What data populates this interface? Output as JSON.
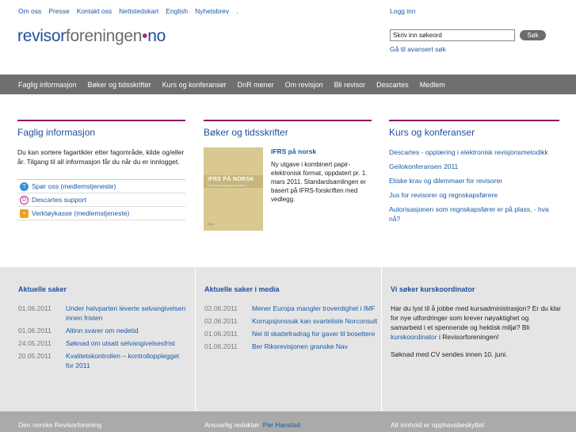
{
  "header": {
    "top_links": [
      "Om oss",
      "Presse",
      "Kontakt oss",
      "Nettstedskart",
      "English",
      "Nyhetsbrev",
      "."
    ],
    "login": "Logg inn",
    "logo": {
      "part1": "revisor",
      "part2": "foreningen",
      "dot": "•",
      "part3": "no"
    },
    "search_value": "Skriv inn søkeord",
    "search_button": "Søk",
    "advanced_search": "Gå til avansert søk"
  },
  "nav": [
    "Faglig informasjon",
    "Bøker og tidsskrifter",
    "Kurs og konferanser",
    "DnR mener",
    "Om revisjon",
    "Bli revisor",
    "Descartes",
    "Medlem"
  ],
  "col1": {
    "title": "Faglig informasjon",
    "intro": "Du kan sortere fagartikler etter fagområde, kilde og/eller år. Tilgang til all informasjon får du når du er innlogget.",
    "links": [
      {
        "label": "Spør oss (medlemstjeneste)",
        "icon": "question-icon"
      },
      {
        "label": "Descartes support",
        "icon": "descartes-icon"
      },
      {
        "label": "Verktøykasse (medlemstjeneste)",
        "icon": "toolbox-icon"
      }
    ]
  },
  "col2": {
    "title": "Bøker og tidsskrifter",
    "book_title": "IFRS på norsk",
    "book_desc": "Ny utgave i kombinert papir-elektronisk format, oppdatert pr. 1. mars 2011. Standardsamlingen er basert på IFRS-forskriften med vedlegg.",
    "cover_title": "IFRS PÅ NORSK",
    "cover_sub": "Internasjonale regnskapsstandarder",
    "cover_bottom": "2011"
  },
  "col3": {
    "title": "Kurs og konferanser",
    "links": [
      "Descartes - opplæring i elektronisk revisjonsmetodikk",
      "Geilokonferansen 2011",
      "Etiske krav og dilemmaer for revisorer",
      "Jus for revisorer og regnskapsførere",
      "Autorisasjonen som regnskapsfører er på plass, - hva nå?"
    ]
  },
  "news1": {
    "title": "Aktuelle saker",
    "items": [
      {
        "date": "01.06.2011",
        "text": "Under halvparten leverte selvangivelsen innen fristen"
      },
      {
        "date": "01.06.2011",
        "text": "Altinn svarer om nedetid"
      },
      {
        "date": "24.05.2011",
        "text": "Søknad om utsatt selvangivelsesfrist"
      },
      {
        "date": "20.05.2011",
        "text": "Kvalitetskontrollen – kontrollopplegget for 2011"
      }
    ]
  },
  "news2": {
    "title": "Aktuelle saker i media",
    "items": [
      {
        "date": "02.06.2011",
        "text": "Mener Europa mangler troverdighet i IMF"
      },
      {
        "date": "02.06.2011",
        "text": "Korrupsjonssak kan svarteliste Norconsult"
      },
      {
        "date": "01.06.2011",
        "text": "Nei til skattefradrag for gaver til bosettere"
      },
      {
        "date": "01.06.2011",
        "text": "Ber Riksrevisjonen granske Nav"
      }
    ]
  },
  "recruit": {
    "title": "Vi søker kurskoordinator",
    "p1_a": "Har du lyst til å jobbe med kursadministrasjon? Er du klar for nye utfordringer som krever nøyaktighet og samarbeid i et spennende og hektisk miljø? Bli ",
    "p1_link": "kurskoordinator",
    "p1_b": " i Revisorforeningen!",
    "p2": "Søknad med CV sendes innen 10. juni."
  },
  "footer": {
    "org": "Den norske Revisorforening",
    "editor_label": "Ansvarlig redaktør: ",
    "editor_name": "Per Hanstad",
    "copyright": "Alt innhold er opphavsbeskyttet"
  },
  "colors": {
    "nav_bg": "#6f6f6f",
    "accent": "#8b1a6a",
    "link": "#1a5aa5",
    "band": "#e5e5e5"
  }
}
